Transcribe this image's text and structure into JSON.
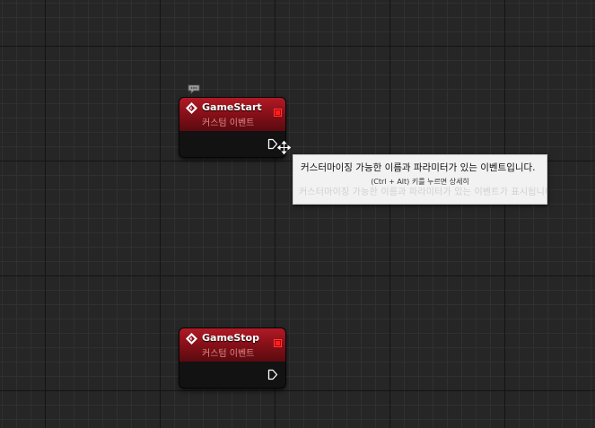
{
  "nodes": [
    {
      "title": "GameStart",
      "subtitle": "커스텀 이벤트"
    },
    {
      "title": "GameStop",
      "subtitle": "커스텀 이벤트"
    }
  ],
  "tooltip": {
    "text": "커스터마이징 가능한 이름과 파라미터가 있는 이벤트입니다.",
    "hint": "(Ctrl + Alt) 키를 누르면 상세히",
    "ghost_text": "커스터마이징 가능한 이름과 파라미터가 있는 이벤트가 표시됩니다"
  },
  "colors": {
    "graph_background": "#262626",
    "node_header": "#8a1019",
    "node_subtitle": "#d98a88",
    "delegate_pin": "#ff1e1e",
    "tooltip_background": "#f2f2f2"
  },
  "icons": [
    "event-diamond-icon",
    "delegate-pin-icon",
    "exec-pin-icon",
    "comment-bubble-icon",
    "move-cursor-icon"
  ]
}
